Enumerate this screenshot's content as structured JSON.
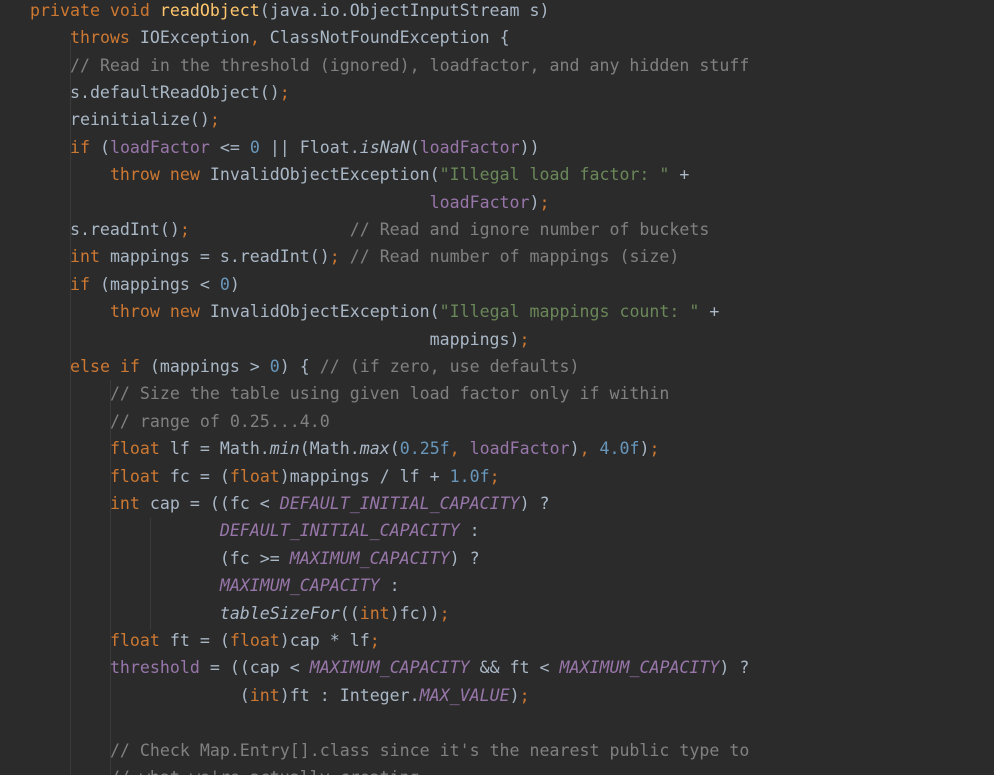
{
  "editor": {
    "colors": {
      "background": "#2b2b2b",
      "default": "#a9b7c6",
      "kw": "#cc7832",
      "fn": "#ffc66d",
      "num": "#6897bb",
      "str": "#6a8759",
      "cmt": "#808080",
      "fld": "#9876aa",
      "con": "#9876aa"
    },
    "lines": [
      {
        "tokens": [
          {
            "t": "private void ",
            "c": "kw"
          },
          {
            "t": "readObject",
            "c": "fn"
          },
          {
            "t": "(java.io.ObjectInputStream s)",
            "c": ""
          }
        ]
      },
      {
        "tokens": [
          {
            "t": "    ",
            "c": ""
          },
          {
            "t": "throws ",
            "c": "kw"
          },
          {
            "t": "IOException",
            "c": ""
          },
          {
            "t": ", ",
            "c": "kw"
          },
          {
            "t": "ClassNotFoundException {",
            "c": ""
          }
        ]
      },
      {
        "tokens": [
          {
            "t": "    ",
            "c": ""
          },
          {
            "t": "// Read in the threshold (ignored), loadfactor, and any hidden stuff",
            "c": "cmt"
          }
        ]
      },
      {
        "tokens": [
          {
            "t": "    s.defaultReadObject()",
            "c": ""
          },
          {
            "t": ";",
            "c": "kw"
          }
        ]
      },
      {
        "tokens": [
          {
            "t": "    reinitialize()",
            "c": ""
          },
          {
            "t": ";",
            "c": "kw"
          }
        ]
      },
      {
        "tokens": [
          {
            "t": "    ",
            "c": ""
          },
          {
            "t": "if ",
            "c": "kw"
          },
          {
            "t": "(",
            "c": ""
          },
          {
            "t": "loadFactor",
            "c": "fld"
          },
          {
            "t": " <= ",
            "c": ""
          },
          {
            "t": "0",
            "c": "num"
          },
          {
            "t": " || Float.",
            "c": ""
          },
          {
            "t": "isNaN",
            "c": "sm"
          },
          {
            "t": "(",
            "c": ""
          },
          {
            "t": "loadFactor",
            "c": "fld"
          },
          {
            "t": "))",
            "c": ""
          }
        ]
      },
      {
        "tokens": [
          {
            "t": "        ",
            "c": ""
          },
          {
            "t": "throw new ",
            "c": "kw"
          },
          {
            "t": "InvalidObjectException(",
            "c": ""
          },
          {
            "t": "\"Illegal load factor: \"",
            "c": "str"
          },
          {
            "t": " +",
            "c": ""
          }
        ]
      },
      {
        "tokens": [
          {
            "t": "                                        ",
            "c": ""
          },
          {
            "t": "loadFactor",
            "c": "fld"
          },
          {
            "t": ")",
            "c": ""
          },
          {
            "t": ";",
            "c": "kw"
          }
        ]
      },
      {
        "tokens": [
          {
            "t": "    s.readInt()",
            "c": ""
          },
          {
            "t": ";",
            "c": "kw"
          },
          {
            "t": "                ",
            "c": ""
          },
          {
            "t": "// Read and ignore number of buckets",
            "c": "cmt"
          }
        ]
      },
      {
        "tokens": [
          {
            "t": "    ",
            "c": ""
          },
          {
            "t": "int ",
            "c": "kw"
          },
          {
            "t": "mappings = s.readInt()",
            "c": ""
          },
          {
            "t": "; ",
            "c": "kw"
          },
          {
            "t": "// Read number of mappings (size)",
            "c": "cmt"
          }
        ]
      },
      {
        "tokens": [
          {
            "t": "    ",
            "c": ""
          },
          {
            "t": "if ",
            "c": "kw"
          },
          {
            "t": "(mappings < ",
            "c": ""
          },
          {
            "t": "0",
            "c": "num"
          },
          {
            "t": ")",
            "c": ""
          }
        ]
      },
      {
        "tokens": [
          {
            "t": "        ",
            "c": ""
          },
          {
            "t": "throw new ",
            "c": "kw"
          },
          {
            "t": "InvalidObjectException(",
            "c": ""
          },
          {
            "t": "\"Illegal mappings count: \"",
            "c": "str"
          },
          {
            "t": " +",
            "c": ""
          }
        ]
      },
      {
        "tokens": [
          {
            "t": "                                        mappings)",
            "c": ""
          },
          {
            "t": ";",
            "c": "kw"
          }
        ]
      },
      {
        "tokens": [
          {
            "t": "    ",
            "c": ""
          },
          {
            "t": "else if ",
            "c": "kw"
          },
          {
            "t": "(mappings > ",
            "c": ""
          },
          {
            "t": "0",
            "c": "num"
          },
          {
            "t": ") { ",
            "c": ""
          },
          {
            "t": "// (if zero, use defaults)",
            "c": "cmt"
          }
        ]
      },
      {
        "tokens": [
          {
            "t": "        ",
            "c": ""
          },
          {
            "t": "// Size the table using given load factor only if within",
            "c": "cmt"
          }
        ]
      },
      {
        "tokens": [
          {
            "t": "        ",
            "c": ""
          },
          {
            "t": "// range of 0.25...4.0",
            "c": "cmt"
          }
        ]
      },
      {
        "tokens": [
          {
            "t": "        ",
            "c": ""
          },
          {
            "t": "float ",
            "c": "kw"
          },
          {
            "t": "lf = Math.",
            "c": ""
          },
          {
            "t": "min",
            "c": "sm"
          },
          {
            "t": "(Math.",
            "c": ""
          },
          {
            "t": "max",
            "c": "sm"
          },
          {
            "t": "(",
            "c": ""
          },
          {
            "t": "0.25f",
            "c": "num"
          },
          {
            "t": ", ",
            "c": "kw"
          },
          {
            "t": "loadFactor",
            "c": "fld"
          },
          {
            "t": ")",
            "c": ""
          },
          {
            "t": ", ",
            "c": "kw"
          },
          {
            "t": "4.0f",
            "c": "num"
          },
          {
            "t": ")",
            "c": ""
          },
          {
            "t": ";",
            "c": "kw"
          }
        ]
      },
      {
        "tokens": [
          {
            "t": "        ",
            "c": ""
          },
          {
            "t": "float ",
            "c": "kw"
          },
          {
            "t": "fc = (",
            "c": ""
          },
          {
            "t": "float",
            "c": "kw"
          },
          {
            "t": ")mappings / lf + ",
            "c": ""
          },
          {
            "t": "1.0f",
            "c": "num"
          },
          {
            "t": ";",
            "c": "kw"
          }
        ]
      },
      {
        "tokens": [
          {
            "t": "        ",
            "c": ""
          },
          {
            "t": "int ",
            "c": "kw"
          },
          {
            "t": "cap = ((fc < ",
            "c": ""
          },
          {
            "t": "DEFAULT_INITIAL_CAPACITY",
            "c": "con"
          },
          {
            "t": ") ?",
            "c": ""
          }
        ]
      },
      {
        "tokens": [
          {
            "t": "                   ",
            "c": ""
          },
          {
            "t": "DEFAULT_INITIAL_CAPACITY",
            "c": "con"
          },
          {
            "t": " :",
            "c": ""
          }
        ]
      },
      {
        "tokens": [
          {
            "t": "                   (fc >= ",
            "c": ""
          },
          {
            "t": "MAXIMUM_CAPACITY",
            "c": "con"
          },
          {
            "t": ") ?",
            "c": ""
          }
        ]
      },
      {
        "tokens": [
          {
            "t": "                   ",
            "c": ""
          },
          {
            "t": "MAXIMUM_CAPACITY",
            "c": "con"
          },
          {
            "t": " :",
            "c": ""
          }
        ]
      },
      {
        "tokens": [
          {
            "t": "                   ",
            "c": ""
          },
          {
            "t": "tableSizeFor",
            "c": "sm"
          },
          {
            "t": "((",
            "c": ""
          },
          {
            "t": "int",
            "c": "kw"
          },
          {
            "t": ")fc))",
            "c": ""
          },
          {
            "t": ";",
            "c": "kw"
          }
        ]
      },
      {
        "tokens": [
          {
            "t": "        ",
            "c": ""
          },
          {
            "t": "float ",
            "c": "kw"
          },
          {
            "t": "ft = (",
            "c": ""
          },
          {
            "t": "float",
            "c": "kw"
          },
          {
            "t": ")cap * lf",
            "c": ""
          },
          {
            "t": ";",
            "c": "kw"
          }
        ]
      },
      {
        "tokens": [
          {
            "t": "        ",
            "c": ""
          },
          {
            "t": "threshold",
            "c": "fld"
          },
          {
            "t": " = ((cap < ",
            "c": ""
          },
          {
            "t": "MAXIMUM_CAPACITY",
            "c": "con"
          },
          {
            "t": " && ft < ",
            "c": ""
          },
          {
            "t": "MAXIMUM_CAPACITY",
            "c": "con"
          },
          {
            "t": ") ?",
            "c": ""
          }
        ]
      },
      {
        "tokens": [
          {
            "t": "                     (",
            "c": ""
          },
          {
            "t": "int",
            "c": "kw"
          },
          {
            "t": ")ft : Integer.",
            "c": ""
          },
          {
            "t": "MAX_VALUE",
            "c": "con"
          },
          {
            "t": ")",
            "c": ""
          },
          {
            "t": ";",
            "c": "kw"
          }
        ]
      },
      {
        "tokens": []
      },
      {
        "tokens": [
          {
            "t": "        ",
            "c": ""
          },
          {
            "t": "// Check Map.Entry[].class since it's the nearest public type to",
            "c": "cmt"
          }
        ]
      },
      {
        "tokens": [
          {
            "t": "        ",
            "c": ""
          },
          {
            "t": "// what we're actually creating.",
            "c": "cmt"
          }
        ]
      }
    ]
  }
}
